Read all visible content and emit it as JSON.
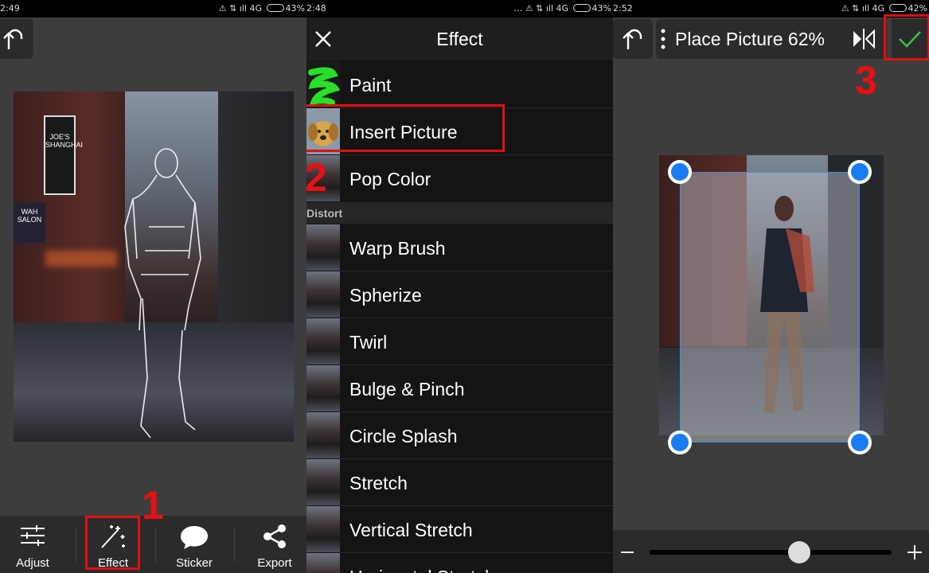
{
  "screens": [
    {
      "status": {
        "time": "2:49",
        "network": "4G",
        "battery": "43%"
      },
      "bottom_tabs": [
        {
          "label": "Adjust",
          "icon": "sliders-icon"
        },
        {
          "label": "Effect",
          "icon": "magic-wand-icon"
        },
        {
          "label": "Sticker",
          "icon": "speech-bubble-icon"
        },
        {
          "label": "Export",
          "icon": "share-icon"
        }
      ],
      "step_number": "1",
      "photo_signs": {
        "left_sign": "JOE'S\nSHANGHAI",
        "wah": "WAH\nSALON"
      }
    },
    {
      "status": {
        "time": "2:48",
        "network": "4G",
        "battery": "43%"
      },
      "title": "Effect",
      "items_top": [
        {
          "label": "Paint",
          "thumb": "paint"
        },
        {
          "label": "Insert Picture",
          "thumb": "dog"
        },
        {
          "label": "Pop Color",
          "thumb": "city"
        }
      ],
      "section": "Distort",
      "items_distort": [
        {
          "label": "Warp Brush"
        },
        {
          "label": "Spherize"
        },
        {
          "label": "Twirl"
        },
        {
          "label": "Bulge & Pinch"
        },
        {
          "label": "Circle Splash"
        },
        {
          "label": "Stretch"
        },
        {
          "label": "Vertical Stretch"
        },
        {
          "label": "Horizontal Stretch"
        }
      ],
      "step_number": "2"
    },
    {
      "status": {
        "time": "2:52",
        "network": "4G",
        "battery": "42%"
      },
      "title": "Place Picture 62%",
      "step_number": "3",
      "zoom_slider_value": 0.62
    }
  ],
  "colors": {
    "accent_red": "#e01010",
    "handle_blue": "#1a7cf2",
    "check_green": "#3fbf3f",
    "paint_green": "#28e028"
  }
}
